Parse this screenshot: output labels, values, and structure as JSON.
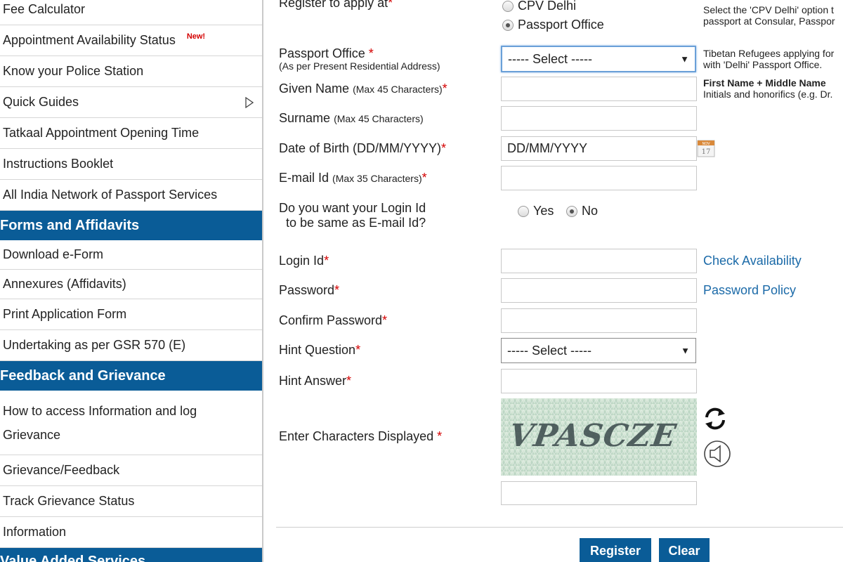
{
  "sidebar": {
    "items_top": [
      {
        "label": "Fee Calculator"
      },
      {
        "label": "Appointment Availability Status",
        "badge": "New!"
      },
      {
        "label": "Know your Police Station"
      },
      {
        "label": "Quick Guides"
      },
      {
        "label": "Tatkaal Appointment Opening Time"
      },
      {
        "label": "Instructions Booklet"
      },
      {
        "label": "All India Network of Passport Services"
      }
    ],
    "forms_header": "Forms and Affidavits",
    "forms_items": [
      {
        "label": "Download e-Form"
      },
      {
        "label": "Annexures (Affidavits)"
      },
      {
        "label": "Print Application Form"
      },
      {
        "label": "Undertaking as per GSR 570 (E)"
      }
    ],
    "feedback_header": "Feedback and Grievance",
    "feedback_items": [
      {
        "label": "How to access Information and log Grievance"
      },
      {
        "label": "Grievance/Feedback"
      },
      {
        "label": "Track Grievance Status"
      },
      {
        "label": "Information"
      }
    ],
    "value_header": "Value Added Services"
  },
  "form": {
    "register_label": "Register to apply at",
    "register_options": [
      {
        "label": "CPV Delhi",
        "selected": false
      },
      {
        "label": "Passport Office",
        "selected": true
      }
    ],
    "passport_office_label": "Passport Office",
    "passport_office_sub": "(As per Present Residential Address)",
    "passport_office_value": "----- Select -----",
    "given_name_label": "Given Name",
    "given_name_hint": "(Max 45 Characters)",
    "surname_label": "Surname",
    "surname_hint": "(Max 45 Characters)",
    "dob_label": "Date of Birth (DD/MM/YYYY)",
    "dob_value": "DD/MM/YYYY",
    "email_label": "E-mail Id",
    "email_hint": "(Max 35 Characters)",
    "login_same_line1": "Do you want your Login Id",
    "login_same_line2": "to be same as E-mail Id?",
    "login_same_options": [
      {
        "label": "Yes",
        "selected": false
      },
      {
        "label": "No",
        "selected": true
      }
    ],
    "login_id_label": "Login Id",
    "password_label": "Password",
    "confirm_password_label": "Confirm Password",
    "hint_question_label": "Hint Question",
    "hint_question_value": "----- Select -----",
    "hint_answer_label": "Hint Answer",
    "captcha_label": "Enter Characters Displayed",
    "captcha_text": "VPASCZE",
    "required_mark": "*",
    "caret": "▼"
  },
  "help": {
    "cpv_line1": "Select the 'CPV Delhi' option t",
    "cpv_line2": "passport at Consular, Passpor",
    "tibetan_line1": "Tibetan Refugees applying for",
    "tibetan_line2": "with 'Delhi' Passport Office.",
    "name_bold": "First Name + Middle Name",
    "name_line2": "Initials and honorifics (e.g. Dr."
  },
  "links": {
    "check_availability": "Check Availability",
    "password_policy": "Password Policy"
  },
  "calendar": {
    "month": "NOV",
    "day": "17"
  },
  "buttons": {
    "register": "Register",
    "clear": "Clear"
  },
  "colors": {
    "header_blue": "#0a5c97",
    "link_blue": "#1b6aa8",
    "required_red": "#d40000"
  }
}
